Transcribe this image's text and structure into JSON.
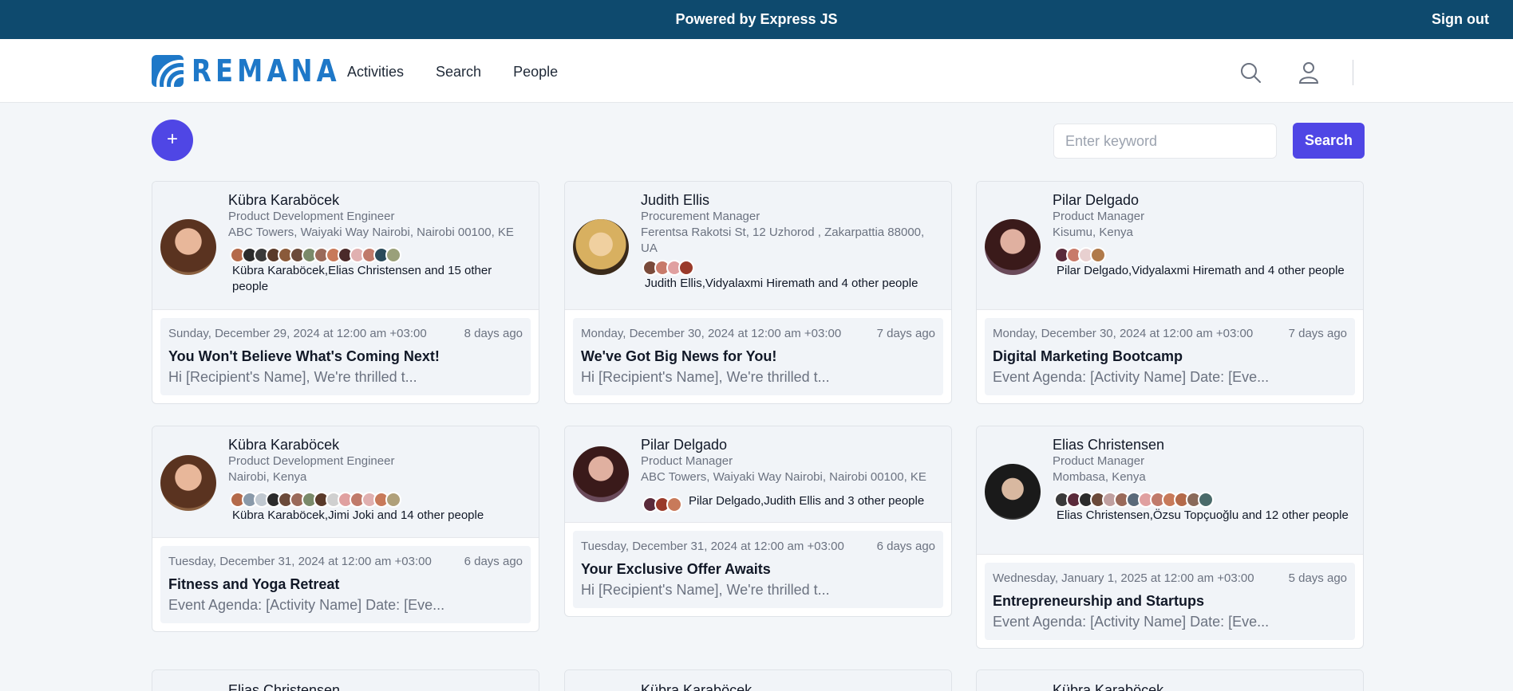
{
  "topbar": {
    "powered": "Powered by Express JS",
    "signout": "Sign out"
  },
  "nav": {
    "logo_text": "REMANA",
    "links": [
      "Activities",
      "Search",
      "People"
    ],
    "brand_color": "#1e78c8"
  },
  "search": {
    "placeholder": "Enter keyword",
    "button": "Search",
    "add_icon": "+"
  },
  "cards": [
    {
      "name": "Kübra Karaböcek",
      "role": "Product Development Engineer",
      "location": "ABC Towers, Waiyaki Way Nairobi, Nairobi 00100, KE",
      "people": "Kübra Karaböcek,Elias Christensen and 15 other people",
      "date": "Sunday, December 29, 2024 at 12:00 am +03:00",
      "ago": "8 days ago",
      "title": "You Won't Believe What's Coming Next!",
      "excerpt": "Hi [Recipient's Name], We're thrilled t..."
    },
    {
      "name": "Judith Ellis",
      "role": "Procurement Manager",
      "location": "Ferentsa Rakotsi St, 12 Uzhorod , Zakarpattia 88000, UA",
      "people": "Judith Ellis,Vidyalaxmi Hiremath and 4 other people",
      "date": "Monday, December 30, 2024 at 12:00 am +03:00",
      "ago": "7 days ago",
      "title": "We've Got Big News for You!",
      "excerpt": "Hi [Recipient's Name], We're thrilled t..."
    },
    {
      "name": "Pilar Delgado",
      "role": "Product Manager",
      "location": "Kisumu, Kenya",
      "people": "Pilar Delgado,Vidyalaxmi Hiremath and 4 other people",
      "date": "Monday, December 30, 2024 at 12:00 am +03:00",
      "ago": "7 days ago",
      "title": "Digital Marketing Bootcamp",
      "excerpt": "Event Agenda: [Activity Name] Date: [Eve..."
    },
    {
      "name": "Kübra Karaböcek",
      "role": "Product Development Engineer",
      "location": "Nairobi, Kenya",
      "people": "Kübra Karaböcek,Jimi Joki and 14 other people",
      "date": "Tuesday, December 31, 2024 at 12:00 am +03:00",
      "ago": "6 days ago",
      "title": "Fitness and Yoga Retreat",
      "excerpt": "Event Agenda: [Activity Name] Date: [Eve..."
    },
    {
      "name": "Pilar Delgado",
      "role": "Product Manager",
      "location": "ABC Towers, Waiyaki Way Nairobi, Nairobi 00100, KE",
      "people": "Pilar Delgado,Judith Ellis and 3 other people",
      "date": "Tuesday, December 31, 2024 at 12:00 am +03:00",
      "ago": "6 days ago",
      "title": "Your Exclusive Offer Awaits",
      "excerpt": "Hi [Recipient's Name], We're thrilled t..."
    },
    {
      "name": "Elias Christensen",
      "role": "Product Manager",
      "location": "Mombasa, Kenya",
      "people": "Elias Christensen,Özsu Topçuoğlu and 12 other people",
      "date": "Wednesday, January 1, 2025 at 12:00 am +03:00",
      "ago": "5 days ago",
      "title": "Entrepreneurship and Startups",
      "excerpt": "Event Agenda: [Activity Name] Date: [Eve..."
    }
  ],
  "partial_cards": [
    "Elias Christensen",
    "Kübra Karaböcek",
    "Kübra Karaböcek"
  ]
}
